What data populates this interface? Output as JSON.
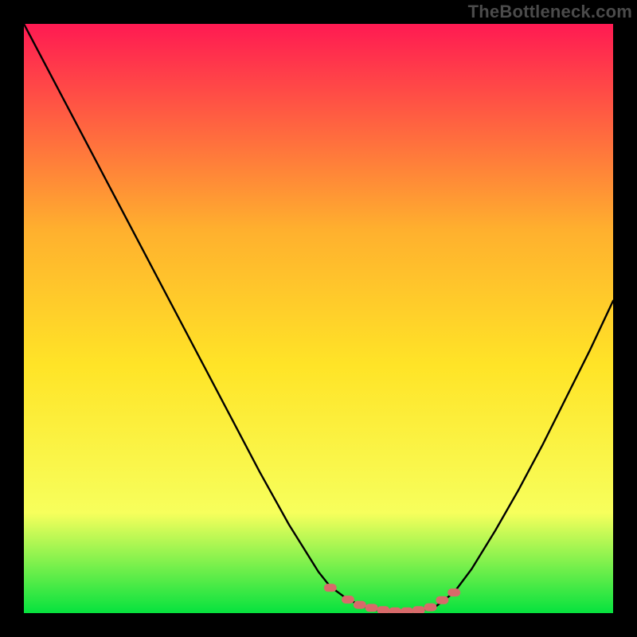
{
  "watermark": "TheBottleneck.com",
  "chart_data": {
    "type": "line",
    "title": "",
    "xlabel": "",
    "ylabel": "",
    "xlim": [
      0,
      100
    ],
    "ylim": [
      0,
      100
    ],
    "grid": false,
    "legend": false,
    "annotations": [],
    "series": [
      {
        "name": "curve",
        "color": "#000000",
        "x": [
          0,
          5,
          10,
          15,
          20,
          25,
          30,
          35,
          40,
          45,
          50,
          52,
          55,
          58,
          60,
          63,
          66,
          68,
          70,
          73,
          76,
          80,
          84,
          88,
          92,
          96,
          100
        ],
        "y": [
          100,
          90.5,
          81,
          71.5,
          62,
          52.5,
          43,
          33.5,
          24,
          15,
          7,
          4.5,
          2.3,
          1.0,
          0.5,
          0.3,
          0.3,
          0.6,
          1.2,
          3.5,
          7.5,
          14,
          21,
          28.5,
          36.5,
          44.5,
          53
        ]
      }
    ],
    "markers": {
      "name": "flat-region",
      "color": "#d86a6a",
      "x": [
        52,
        55,
        57,
        59,
        61,
        63,
        65,
        67,
        69,
        71,
        73
      ],
      "y": [
        4.3,
        2.3,
        1.4,
        0.9,
        0.5,
        0.3,
        0.3,
        0.5,
        1.0,
        2.2,
        3.5
      ]
    },
    "background_gradient": {
      "top": "#ff1a52",
      "upper_mid": "#ffb02e",
      "mid": "#ffe427",
      "lower": "#f7ff5c",
      "bottom": "#06e23e"
    }
  }
}
